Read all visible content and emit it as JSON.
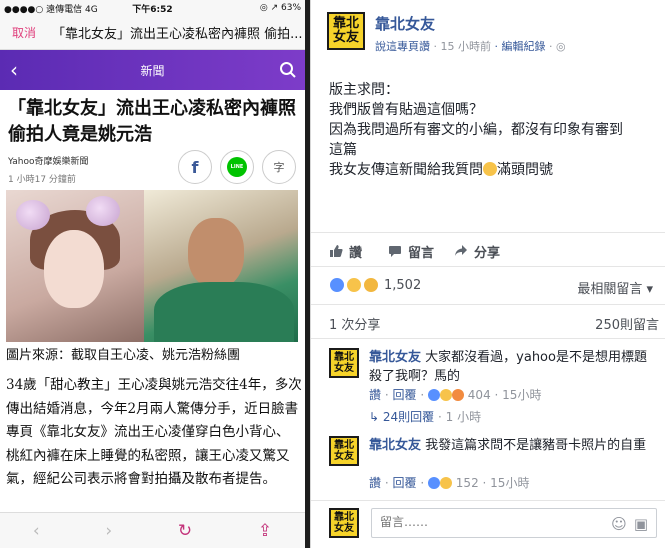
{
  "left": {
    "status": {
      "carrier": "●●●●○ 遠傳電信  4G",
      "time": "下午6:52",
      "battery": "◎ ↗ 63%"
    },
    "address": {
      "cancel_label": "取消",
      "text": "「靠北女友」流出王心凌私密內褲照 偷拍..."
    },
    "nav": {
      "title": "新聞",
      "back_icon": "chevron-left-icon",
      "search_icon": "search-icon"
    },
    "article": {
      "headline": "「靠北女友」流出王心凌私密內褲照偷拍人竟是姚元浩",
      "source": "Yahoo奇摩娛樂新聞",
      "time": "1 小時17 分鐘前",
      "share_fb": "f",
      "share_line": "LINE",
      "font_button": "字",
      "image_caption": "圖片來源：截取自王心凌、姚元浩粉絲團",
      "body": "34歲「甜心教主」王心凌與姚元浩交往4年，多次傳出結婚消息，今年2月兩人驚傳分手，近日臉書專頁《靠北女友》流出王心凌僅穿白色小背心、桃紅內褲在床上睡覺的私密照，讓王心凌又驚又氣，經紀公司表示將會對拍攝及散布者提告。"
    },
    "bottom_bar": {
      "back": "‹",
      "forward": "›",
      "reload": "↻",
      "share": "⇪"
    }
  },
  "right": {
    "post": {
      "logo_line1": "靠北",
      "logo_line2": "女友",
      "page_name": "靠北女友",
      "meta_prefix": "說這專頁讚",
      "meta_time": "· 15 小時前",
      "meta_edit": "· 編輯紀錄",
      "meta_globe": "· ◎",
      "lines": [
        "版主求問：",
        "我們版曾有貼過這個嗎？",
        "因為我問過所有審文的小編，都沒有印象有審到",
        "這篇",
        "我女友傳這新聞給我質問",
        "滿頭問號"
      ]
    },
    "actions": {
      "like": "讚",
      "comment": "留言",
      "share": "分享"
    },
    "reactions": {
      "count": "1,502",
      "sort_label": "最相關留言 ▾"
    },
    "shares": {
      "count": "1 次分享",
      "comments": "250則留言"
    },
    "comments": [
      {
        "name": "靠北女友",
        "text": "大家都沒看過，yahoo是不是想用標題殺了我啊？馬的",
        "like": "讚",
        "reply": "回覆",
        "count": "404",
        "time": "15小時"
      },
      {
        "name": "靠北女友",
        "text": "我發這篇求問不是讓豬哥卡照片的自重",
        "like": "讚",
        "reply": "回覆",
        "count": "152",
        "time": "15小時"
      }
    ],
    "replies_link": {
      "label": "24則回覆",
      "time": "· 1 小時"
    },
    "comment_box": {
      "placeholder": "留言……"
    }
  }
}
